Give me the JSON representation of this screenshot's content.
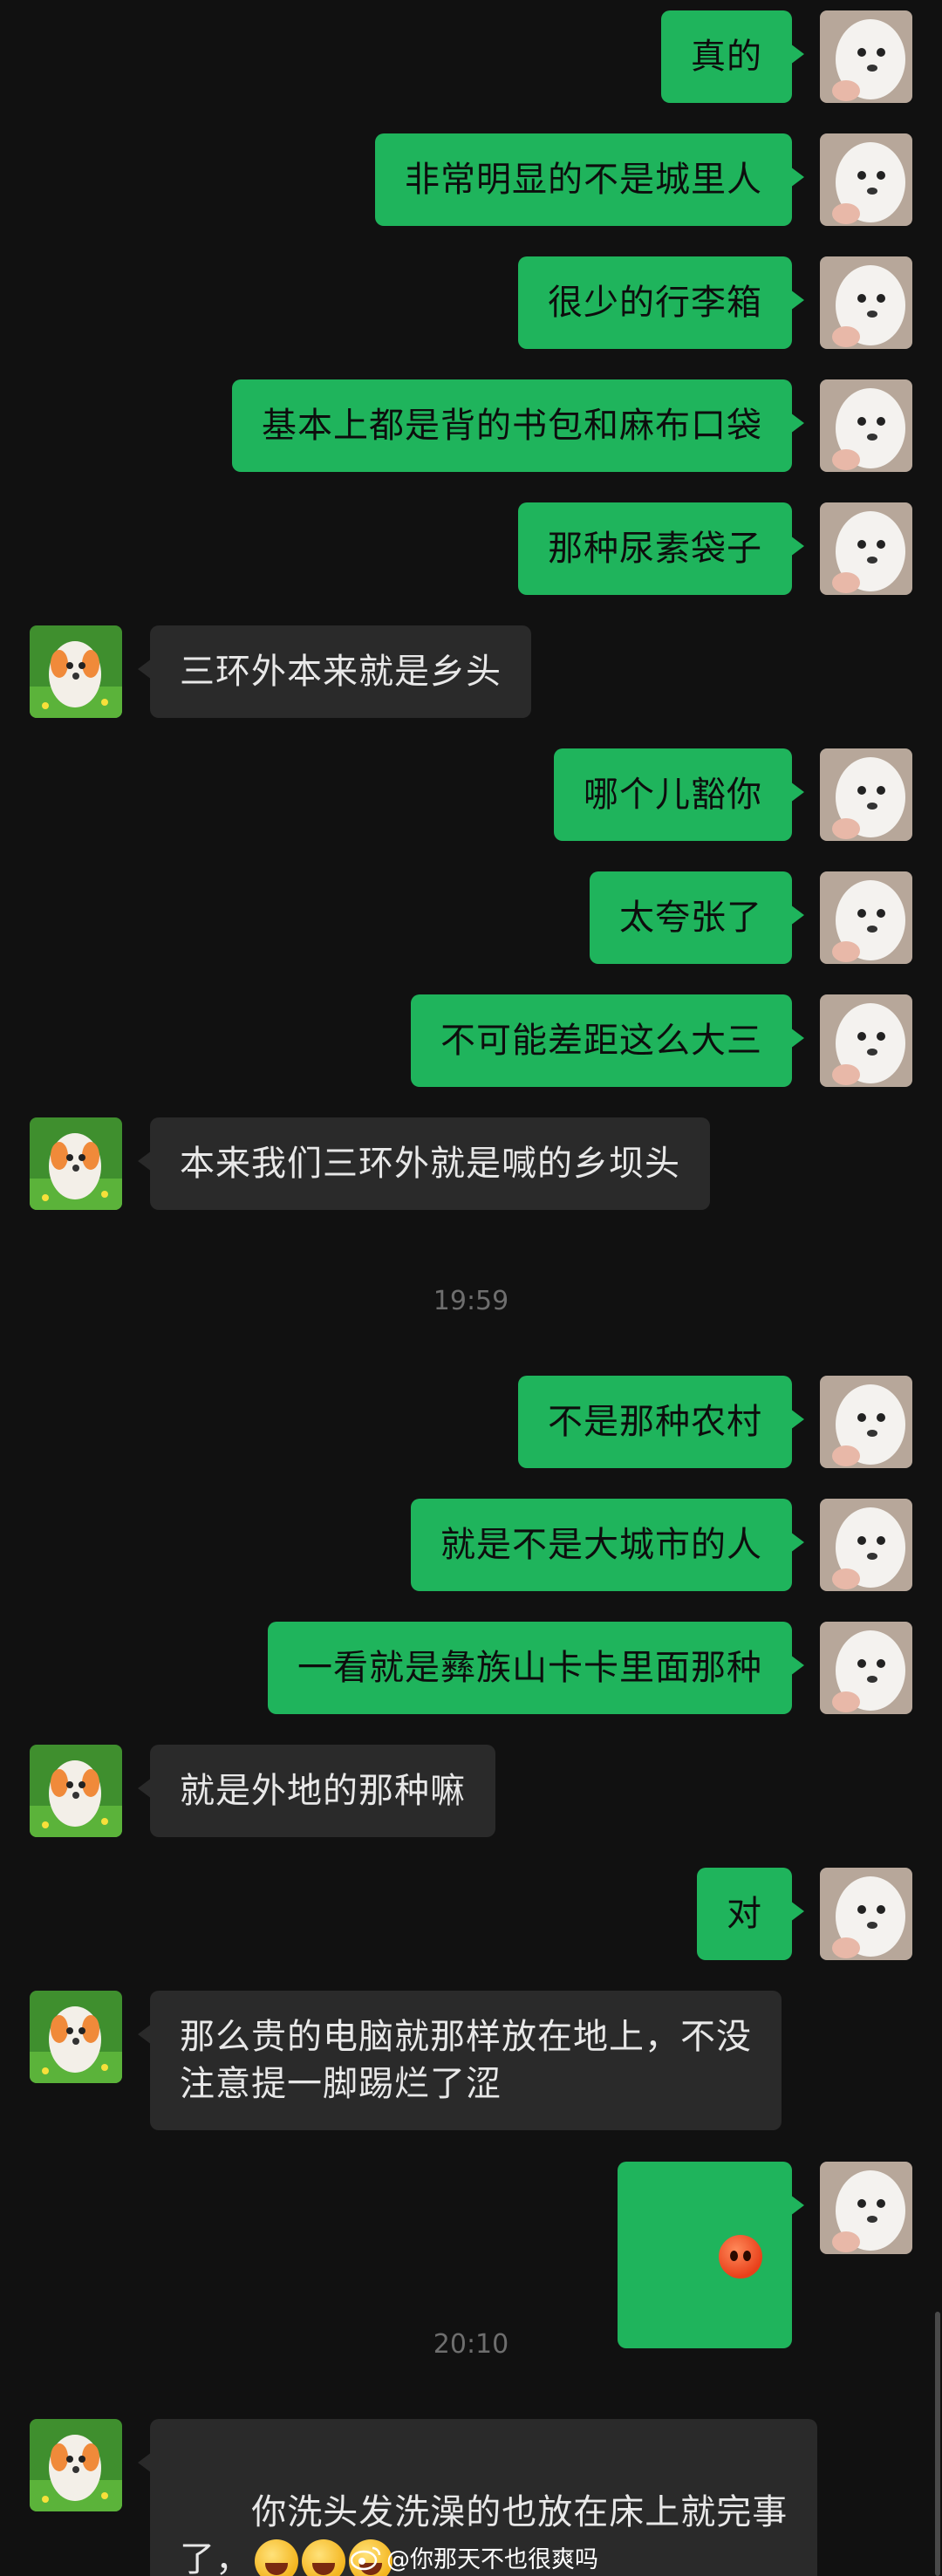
{
  "messages": [
    {
      "side": "me",
      "text": "真的",
      "time": null
    },
    {
      "side": "me",
      "text": "非常明显的不是城里人"
    },
    {
      "side": "me",
      "text": "很少的行李箱"
    },
    {
      "side": "me",
      "text": "基本上都是背的书包和麻布口袋"
    },
    {
      "side": "me",
      "text": "那种尿素袋子"
    },
    {
      "side": "them",
      "text": "三环外本来就是乡头"
    },
    {
      "side": "me",
      "text": "哪个儿豁你"
    },
    {
      "side": "me",
      "text": "太夸张了"
    },
    {
      "side": "me",
      "text": "不可能差距这么大三"
    },
    {
      "side": "them",
      "text": "本来我们三环外就是喊的乡坝头"
    },
    {
      "side": "me",
      "text": "不是那种农村"
    },
    {
      "side": "me",
      "text": "就是不是大城市的人"
    },
    {
      "side": "me",
      "text": "一看就是彝族山卡卡里面那种"
    },
    {
      "side": "them",
      "text": "就是外地的那种嘛"
    },
    {
      "side": "me",
      "text": "对"
    },
    {
      "side": "them",
      "text": "那么贵的电脑就那样放在地上，不没\n注意提一脚踢烂了涩"
    },
    {
      "side": "me",
      "text": "",
      "emoji": "angry-face-emoji"
    },
    {
      "side": "them",
      "text": "你洗头发洗澡的也放在床上就完事\n了，",
      "emoji": "laughing-emoji x3"
    }
  ],
  "timestamps": [
    "19:59",
    "20:10"
  ],
  "watermark": "@你那天不也很爽吗",
  "colors": {
    "background": "#111111",
    "my_bubble": "#1fb45c",
    "their_bubble": "#2a2a2a",
    "timestamp": "#6e6e6e"
  }
}
